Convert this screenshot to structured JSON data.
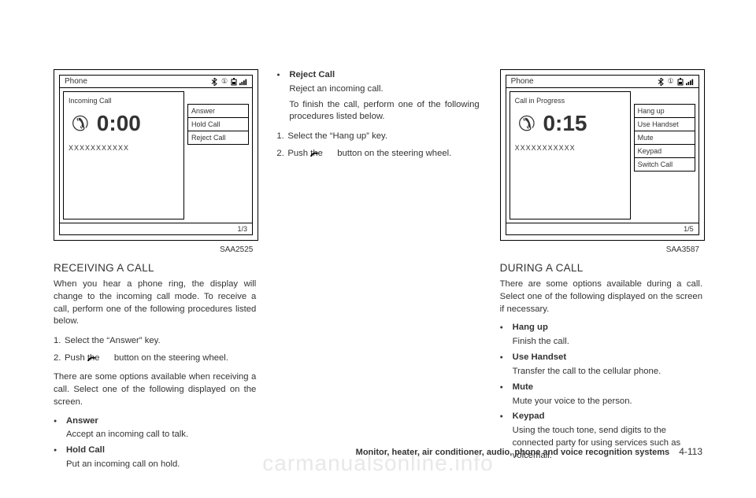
{
  "figure1": {
    "status_title": "Phone",
    "call_status": "Incoming Call",
    "timer": "0:00",
    "number": "XXXXXXXXXXX",
    "options": [
      "Answer",
      "Hold Call",
      "Reject Call"
    ],
    "page_indicator": "1/3",
    "fig_id": "SAA2525"
  },
  "figure2": {
    "status_title": "Phone",
    "call_status": "Call in Progress",
    "timer": "0:15",
    "number": "XXXXXXXXXXX",
    "options": [
      "Hang up",
      "Use Handset",
      "Mute",
      "Keypad",
      "Switch Call"
    ],
    "page_indicator": "1/5",
    "fig_id": "SAA3587"
  },
  "col1": {
    "heading": "RECEIVING A CALL",
    "intro": "When you hear a phone ring, the display will change to the incoming call mode. To receive a call, perform one of the following procedures listed below.",
    "step1": "Select the “Answer” key.",
    "step2a": "Push the",
    "step2b": "button on the steering wheel.",
    "mid": "There are some options available when receiving a call. Select one of the following displayed on the screen.",
    "b1t": "Answer",
    "b1d": "Accept an incoming call to talk.",
    "b2t": "Hold Call",
    "b2d": "Put an incoming call on hold."
  },
  "col2": {
    "b3t": "Reject Call",
    "b3d": "Reject an incoming call.",
    "finish": "To finish the call, perform one of the following procedures listed below.",
    "step1": "Select the “Hang up” key.",
    "step2a": "Push the",
    "step2b": "button on the steering wheel."
  },
  "col3": {
    "heading": "DURING A CALL",
    "intro": "There are some options available during a call. Select one of the following displayed on the screen if necessary.",
    "b1t": "Hang up",
    "b1d": "Finish the call.",
    "b2t": "Use Handset",
    "b2d": "Transfer the call to the cellular phone.",
    "b3t": "Mute",
    "b3d": "Mute your voice to the person.",
    "b4t": "Keypad",
    "b4d": "Using the touch tone, send digits to the connected party for using services such as voicemail."
  },
  "footer": {
    "section": "Monitor, heater, air conditioner, audio, phone and voice recognition systems",
    "page": "4-113"
  },
  "watermark": "carmanualsonline.info"
}
